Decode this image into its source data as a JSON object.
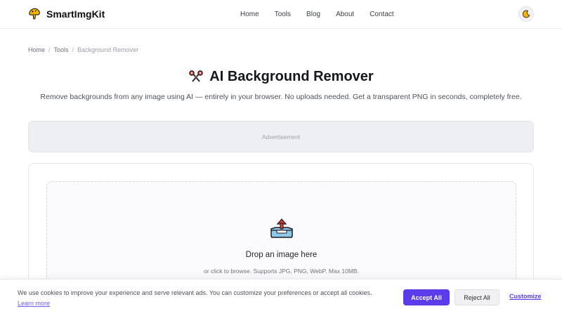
{
  "brand": {
    "name": "SmartImgKit"
  },
  "nav": {
    "items": [
      {
        "label": "Home"
      },
      {
        "label": "Tools"
      },
      {
        "label": "Blog"
      },
      {
        "label": "About"
      },
      {
        "label": "Contact"
      }
    ]
  },
  "breadcrumb": {
    "items": [
      "Home",
      "Tools",
      "Background Remover"
    ],
    "separator": "/"
  },
  "page": {
    "title": "AI Background Remover",
    "subtitle": "Remove backgrounds from any image using AI — entirely in your browser. No uploads needed. Get a transparent PNG in seconds, completely free."
  },
  "ad": {
    "label": "Advertisement"
  },
  "dropzone": {
    "title": "Drop an image here",
    "subtitle": "or click to browse. Supports JPG, PNG, WebP. Max 10MB."
  },
  "cookie": {
    "text": "We use cookies to improve your experience and serve relevant ads. You can customize your preferences or accept all cookies.",
    "learn_more": "Learn more",
    "accept": "Accept All",
    "reject": "Reject All",
    "customize": "Customize"
  },
  "icons": {
    "logo": "mushroom-logo-icon",
    "theme": "moon-icon",
    "title": "scissors-icon",
    "upload": "upload-tray-icon"
  },
  "colors": {
    "accent": "#5b3bea",
    "link": "#6b5cf6"
  }
}
